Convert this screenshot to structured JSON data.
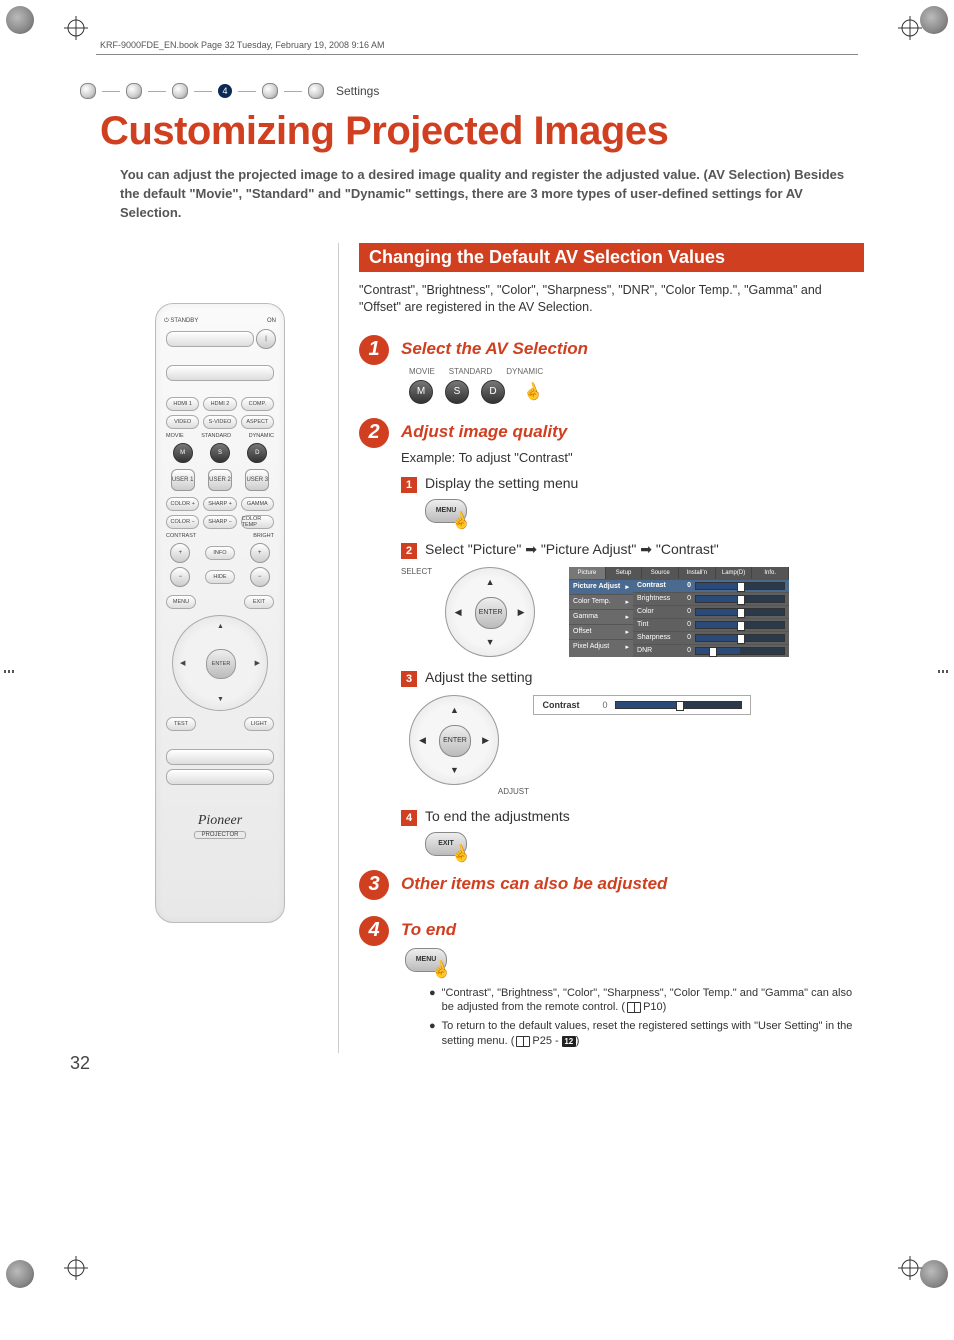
{
  "meta": {
    "book_header": "KRF-9000FDE_EN.book  Page 32  Tuesday, February 19, 2008  9:16 AM"
  },
  "breadcrumb": {
    "step_number": "4",
    "label": "Settings"
  },
  "title": "Customizing Projected Images",
  "intro": "You can adjust the projected image to a desired image quality and register the adjusted value. (AV Selection) Besides the default \"Movie\", \"Standard\" and \"Dynamic\" settings, there are 3 more types of user-defined settings for AV Selection.",
  "section_bar": "Changing the Default AV Selection Values",
  "section_desc": "\"Contrast\", \"Brightness\", \"Color\", \"Sharpness\", \"DNR\", \"Color Temp.\", \"Gamma\" and \"Offset\" are registered in the AV Selection.",
  "steps": {
    "s1": {
      "num": "1",
      "title": "Select the AV Selection",
      "labels": {
        "movie": "MOVIE",
        "standard": "STANDARD",
        "dynamic": "DYNAMIC"
      },
      "buttons": {
        "m": "M",
        "s": "S",
        "d": "D"
      }
    },
    "s2": {
      "num": "2",
      "title": "Adjust image quality",
      "example": "Example: To adjust \"Contrast\"",
      "sub1": {
        "n": "1",
        "text": "Display the setting menu"
      },
      "menu_label": "MENU",
      "sub2": {
        "n": "2",
        "text": "Select \"Picture\" ➡ \"Picture Adjust\" ➡ \"Contrast\""
      },
      "select_lbl": "SELECT",
      "enter_lbl": "ENTER",
      "sub3": {
        "n": "3",
        "text": "Adjust the setting"
      },
      "adjust_lbl": "ADJUST",
      "sub4": {
        "n": "4",
        "text": "To end the adjustments"
      },
      "exit_label": "EXIT"
    },
    "s3": {
      "num": "3",
      "title": "Other items can also be adjusted"
    },
    "s4": {
      "num": "4",
      "title": "To end"
    }
  },
  "osd": {
    "tabs": [
      "Picture",
      "Setup",
      "Source",
      "Install’n",
      "Lamp(D)",
      "Info."
    ],
    "left": [
      {
        "label": "Picture Adjust",
        "selected": true
      },
      {
        "label": "Color Temp."
      },
      {
        "label": "Gamma"
      },
      {
        "label": "Offset"
      },
      {
        "label": "Pixel Adjust"
      }
    ],
    "right": [
      {
        "label": "Contrast",
        "value": "0",
        "selected": true
      },
      {
        "label": "Brightness",
        "value": "0"
      },
      {
        "label": "Color",
        "value": "0"
      },
      {
        "label": "Tint",
        "value": "0"
      },
      {
        "label": "Sharpness",
        "value": "0"
      },
      {
        "label": "DNR",
        "value": "0",
        "low": true
      }
    ]
  },
  "contrast_bar": {
    "label": "Contrast",
    "value": "0"
  },
  "notes": {
    "n1": "\"Contrast\", \"Brightness\", \"Color\", \"Sharpness\", \"Color Temp.\" and \"Gamma\" can also be adjusted from the remote control. (",
    "n1_ref": "P10",
    "n1_tail": ")",
    "n2": "To return to the default values, reset the registered settings with \"User Setting\" in the setting menu. (",
    "n2_ref": "P25 - ",
    "n2_badge": "12",
    "n2_tail": ")"
  },
  "page_number": "32",
  "remote": {
    "standby": "STANDBY",
    "on": "ON",
    "hdmi1": "HDMI 1",
    "hdmi2": "HDMI 2",
    "comp": "COMP.",
    "video": "VIDEO",
    "svideo": "S-VIDEO",
    "aspect": "ASPECT",
    "movie": "MOVIE",
    "standard": "STANDARD",
    "dynamic": "DYNAMIC",
    "m": "M",
    "s_": "S",
    "d": "D",
    "user1": "USER 1",
    "user2": "USER 2",
    "user3": "USER 3",
    "colorp": "COLOR +",
    "sharpp": "SHARP +",
    "gamma": "GAMMA",
    "colorm": "COLOR −",
    "sharpm": "SHARP −",
    "ctemp": "COLOR TEMP",
    "contrast": "CONTRAST",
    "bright": "BRIGHT",
    "info": "INFO",
    "hide": "HIDE",
    "menu": "MENU",
    "exit": "EXIT",
    "enter": "ENTER",
    "test": "TEST",
    "light": "LIGHT",
    "brand": "Pioneer",
    "brand_sub": "PROJECTOR"
  }
}
